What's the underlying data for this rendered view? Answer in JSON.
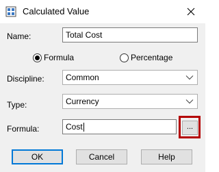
{
  "window": {
    "title": "Calculated Value",
    "icon": "calculator-grid-icon",
    "close_icon": "close-icon"
  },
  "fields": {
    "name_label": "Name:",
    "name_value": "Total Cost",
    "discipline_label": "Discipline:",
    "discipline_value": "Common",
    "type_label": "Type:",
    "type_value": "Currency",
    "formula_label": "Formula:",
    "formula_value": "Cost"
  },
  "options": {
    "formula_label": "Formula",
    "percentage_label": "Percentage",
    "selected": "Formula"
  },
  "buttons": {
    "ellipsis_label": "...",
    "ok_label": "OK",
    "cancel_label": "Cancel",
    "help_label": "Help"
  },
  "colors": {
    "highlight": "#b40000",
    "default_button_border": "#0078d7"
  }
}
